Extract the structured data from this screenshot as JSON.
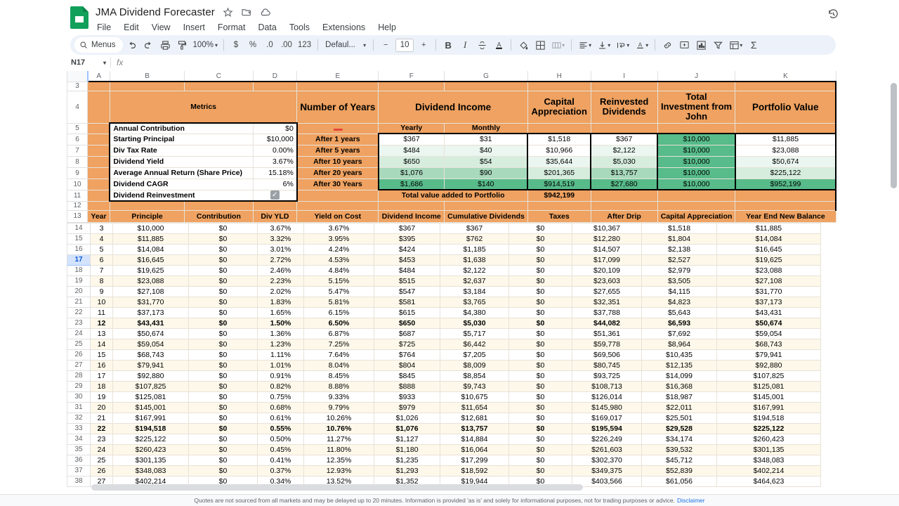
{
  "app": {
    "doc_title": "JMA Dividend Forecaster",
    "doc_icon": "sheets-icon",
    "star_icon": "star-icon",
    "move_icon": "move-to-folder-icon",
    "cloud_icon": "cloud-saved-icon",
    "history_icon": "version-history-icon",
    "menus": [
      "File",
      "Edit",
      "View",
      "Insert",
      "Format",
      "Data",
      "Tools",
      "Extensions",
      "Help"
    ]
  },
  "toolbar": {
    "menus_label": "Menus",
    "search_icon": "search-icon",
    "undo_icon": "undo-icon",
    "redo_icon": "redo-icon",
    "print_icon": "print-icon",
    "paint_icon": "paint-format-icon",
    "zoom_value": "100%",
    "currency_label": "$",
    "percent_label": "%",
    "dec_minus_label": ".0",
    "dec_plus_label": ".00",
    "formats_label": "123",
    "font_label": "Defaul...",
    "font_size": "10",
    "minus_label": "−",
    "plus_label": "+",
    "bold_label": "B",
    "italic_label": "I",
    "strike_label": "S",
    "textcolor_label": "A",
    "fill_icon": "fill-color-icon",
    "borders_icon": "borders-icon",
    "merge_icon": "merge-cells-icon",
    "align_icon": "horizontal-align-icon",
    "valign_icon": "vertical-align-icon",
    "wrap_icon": "text-wrap-icon",
    "rotate_label": "A",
    "link_icon": "insert-link-icon",
    "comment_icon": "insert-comment-icon",
    "chart_icon": "insert-chart-icon",
    "filter_icon": "filter-icon",
    "functions_icon": "pivot-icon",
    "sigma_label": "Σ"
  },
  "formula_bar": {
    "cell_ref": "N17",
    "fx_label": "fx",
    "formula_value": ""
  },
  "grid": {
    "columns": [
      "A",
      "B",
      "C",
      "D",
      "E",
      "F",
      "G",
      "H",
      "I",
      "J",
      "K"
    ],
    "rows": [
      3,
      4,
      5,
      6,
      7,
      8,
      9,
      10,
      11,
      12,
      13,
      14,
      15,
      16,
      17,
      18,
      19,
      20,
      21,
      22,
      23,
      24,
      25,
      26,
      27,
      28,
      29,
      30,
      31,
      32,
      33,
      34,
      35,
      36,
      37,
      38
    ],
    "selected_row": 17
  },
  "panel": {
    "metrics_title": "Metrics",
    "years_title": "Number of Years",
    "dividend_income_title": "Dividend Income",
    "capital_appreciation_title": "Capital Appreciation",
    "reinvested_dividends_title": "Reinvested Dividends",
    "total_investment_title": "Total Investment from John",
    "portfolio_value_title": "Portfolio Value",
    "yearly_label": "Yearly",
    "monthly_label": "Monthly",
    "total_added_label": "Total value added to Portfolio",
    "total_added_value": "$942,199",
    "metrics": [
      {
        "label": "Annual Contribution",
        "value": "$0"
      },
      {
        "label": "Starting Principal",
        "value": "$10,000"
      },
      {
        "label": "Div Tax Rate",
        "value": "0.00%"
      },
      {
        "label": "Dividend Yield",
        "value": "3.67%"
      },
      {
        "label": "Average Annual Return (Share Price)",
        "value": "15.18%"
      },
      {
        "label": "Dividend CAGR",
        "value": "6%"
      },
      {
        "label": "Dividend Reinvestment",
        "value": "✓"
      }
    ],
    "year_rows": [
      {
        "label": "After 1 years",
        "yearly": "$367",
        "monthly": "$31",
        "capital": "$1,518",
        "reinvested": "$367",
        "invested": "$10,000",
        "portfolio": "$11,885"
      },
      {
        "label": "After 5 years",
        "yearly": "$484",
        "monthly": "$40",
        "capital": "$10,966",
        "reinvested": "$2,122",
        "invested": "$10,000",
        "portfolio": "$23,088"
      },
      {
        "label": "After 10 years",
        "yearly": "$650",
        "monthly": "$54",
        "capital": "$35,644",
        "reinvested": "$5,030",
        "invested": "$10,000",
        "portfolio": "$50,674"
      },
      {
        "label": "After 20 years",
        "yearly": "$1,076",
        "monthly": "$90",
        "capital": "$201,365",
        "reinvested": "$13,757",
        "invested": "$10,000",
        "portfolio": "$225,122"
      },
      {
        "label": "After 30 Years",
        "yearly": "$1,686",
        "monthly": "$140",
        "capital": "$914,519",
        "reinvested": "$27,680",
        "invested": "$10,000",
        "portfolio": "$952,199"
      }
    ]
  },
  "table": {
    "headers": [
      "Year",
      "Principle",
      "Contribution",
      "Div YLD",
      "Yield on Cost",
      "Dividend Income",
      "Cumulative Dividends",
      "Taxes",
      "After Drip",
      "Capital Appreciation",
      "Year End New Balance"
    ],
    "rows": [
      {
        "year": "3",
        "principle": "$10,000",
        "contribution": "$0",
        "div_yld": "3.67%",
        "yoc": "3.67%",
        "income": "$367",
        "cumulative": "$367",
        "taxes": "$0",
        "after_drip": "$10,367",
        "capital": "$1,518",
        "balance": "$11,885",
        "bold": false
      },
      {
        "year": "4",
        "principle": "$11,885",
        "contribution": "$0",
        "div_yld": "3.32%",
        "yoc": "3.95%",
        "income": "$395",
        "cumulative": "$762",
        "taxes": "$0",
        "after_drip": "$12,280",
        "capital": "$1,804",
        "balance": "$14,084",
        "bold": false
      },
      {
        "year": "5",
        "principle": "$14,084",
        "contribution": "$0",
        "div_yld": "3.01%",
        "yoc": "4.24%",
        "income": "$424",
        "cumulative": "$1,185",
        "taxes": "$0",
        "after_drip": "$14,507",
        "capital": "$2,138",
        "balance": "$16,645",
        "bold": false
      },
      {
        "year": "6",
        "principle": "$16,645",
        "contribution": "$0",
        "div_yld": "2.72%",
        "yoc": "4.53%",
        "income": "$453",
        "cumulative": "$1,638",
        "taxes": "$0",
        "after_drip": "$17,099",
        "capital": "$2,527",
        "balance": "$19,625",
        "bold": false
      },
      {
        "year": "7",
        "principle": "$19,625",
        "contribution": "$0",
        "div_yld": "2.46%",
        "yoc": "4.84%",
        "income": "$484",
        "cumulative": "$2,122",
        "taxes": "$0",
        "after_drip": "$20,109",
        "capital": "$2,979",
        "balance": "$23,088",
        "bold": false
      },
      {
        "year": "8",
        "principle": "$23,088",
        "contribution": "$0",
        "div_yld": "2.23%",
        "yoc": "5.15%",
        "income": "$515",
        "cumulative": "$2,637",
        "taxes": "$0",
        "after_drip": "$23,603",
        "capital": "$3,505",
        "balance": "$27,108",
        "bold": false
      },
      {
        "year": "9",
        "principle": "$27,108",
        "contribution": "$0",
        "div_yld": "2.02%",
        "yoc": "5.47%",
        "income": "$547",
        "cumulative": "$3,184",
        "taxes": "$0",
        "after_drip": "$27,655",
        "capital": "$4,115",
        "balance": "$31,770",
        "bold": false
      },
      {
        "year": "10",
        "principle": "$31,770",
        "contribution": "$0",
        "div_yld": "1.83%",
        "yoc": "5.81%",
        "income": "$581",
        "cumulative": "$3,765",
        "taxes": "$0",
        "after_drip": "$32,351",
        "capital": "$4,823",
        "balance": "$37,173",
        "bold": false
      },
      {
        "year": "11",
        "principle": "$37,173",
        "contribution": "$0",
        "div_yld": "1.65%",
        "yoc": "6.15%",
        "income": "$615",
        "cumulative": "$4,380",
        "taxes": "$0",
        "after_drip": "$37,788",
        "capital": "$5,643",
        "balance": "$43,431",
        "bold": false
      },
      {
        "year": "12",
        "principle": "$43,431",
        "contribution": "$0",
        "div_yld": "1.50%",
        "yoc": "6.50%",
        "income": "$650",
        "cumulative": "$5,030",
        "taxes": "$0",
        "after_drip": "$44,082",
        "capital": "$6,593",
        "balance": "$50,674",
        "bold": true
      },
      {
        "year": "13",
        "principle": "$50,674",
        "contribution": "$0",
        "div_yld": "1.36%",
        "yoc": "6.87%",
        "income": "$687",
        "cumulative": "$5,717",
        "taxes": "$0",
        "after_drip": "$51,361",
        "capital": "$7,692",
        "balance": "$59,054",
        "bold": false
      },
      {
        "year": "14",
        "principle": "$59,054",
        "contribution": "$0",
        "div_yld": "1.23%",
        "yoc": "7.25%",
        "income": "$725",
        "cumulative": "$6,442",
        "taxes": "$0",
        "after_drip": "$59,778",
        "capital": "$8,964",
        "balance": "$68,743",
        "bold": false
      },
      {
        "year": "15",
        "principle": "$68,743",
        "contribution": "$0",
        "div_yld": "1.11%",
        "yoc": "7.64%",
        "income": "$764",
        "cumulative": "$7,205",
        "taxes": "$0",
        "after_drip": "$69,506",
        "capital": "$10,435",
        "balance": "$79,941",
        "bold": false
      },
      {
        "year": "16",
        "principle": "$79,941",
        "contribution": "$0",
        "div_yld": "1.01%",
        "yoc": "8.04%",
        "income": "$804",
        "cumulative": "$8,009",
        "taxes": "$0",
        "after_drip": "$80,745",
        "capital": "$12,135",
        "balance": "$92,880",
        "bold": false
      },
      {
        "year": "17",
        "principle": "$92,880",
        "contribution": "$0",
        "div_yld": "0.91%",
        "yoc": "8.45%",
        "income": "$845",
        "cumulative": "$8,854",
        "taxes": "$0",
        "after_drip": "$93,725",
        "capital": "$14,099",
        "balance": "$107,825",
        "bold": false
      },
      {
        "year": "18",
        "principle": "$107,825",
        "contribution": "$0",
        "div_yld": "0.82%",
        "yoc": "8.88%",
        "income": "$888",
        "cumulative": "$9,743",
        "taxes": "$0",
        "after_drip": "$108,713",
        "capital": "$16,368",
        "balance": "$125,081",
        "bold": false
      },
      {
        "year": "19",
        "principle": "$125,081",
        "contribution": "$0",
        "div_yld": "0.75%",
        "yoc": "9.33%",
        "income": "$933",
        "cumulative": "$10,675",
        "taxes": "$0",
        "after_drip": "$126,014",
        "capital": "$18,987",
        "balance": "$145,001",
        "bold": false
      },
      {
        "year": "20",
        "principle": "$145,001",
        "contribution": "$0",
        "div_yld": "0.68%",
        "yoc": "9.79%",
        "income": "$979",
        "cumulative": "$11,654",
        "taxes": "$0",
        "after_drip": "$145,980",
        "capital": "$22,011",
        "balance": "$167,991",
        "bold": false
      },
      {
        "year": "21",
        "principle": "$167,991",
        "contribution": "$0",
        "div_yld": "0.61%",
        "yoc": "10.26%",
        "income": "$1,026",
        "cumulative": "$12,681",
        "taxes": "$0",
        "after_drip": "$169,017",
        "capital": "$25,501",
        "balance": "$194,518",
        "bold": false
      },
      {
        "year": "22",
        "principle": "$194,518",
        "contribution": "$0",
        "div_yld": "0.55%",
        "yoc": "10.76%",
        "income": "$1,076",
        "cumulative": "$13,757",
        "taxes": "$0",
        "after_drip": "$195,594",
        "capital": "$29,528",
        "balance": "$225,122",
        "bold": true
      },
      {
        "year": "23",
        "principle": "$225,122",
        "contribution": "$0",
        "div_yld": "0.50%",
        "yoc": "11.27%",
        "income": "$1,127",
        "cumulative": "$14,884",
        "taxes": "$0",
        "after_drip": "$226,249",
        "capital": "$34,174",
        "balance": "$260,423",
        "bold": false
      },
      {
        "year": "24",
        "principle": "$260,423",
        "contribution": "$0",
        "div_yld": "0.45%",
        "yoc": "11.80%",
        "income": "$1,180",
        "cumulative": "$16,064",
        "taxes": "$0",
        "after_drip": "$261,603",
        "capital": "$39,532",
        "balance": "$301,135",
        "bold": false
      },
      {
        "year": "25",
        "principle": "$301,135",
        "contribution": "$0",
        "div_yld": "0.41%",
        "yoc": "12.35%",
        "income": "$1,235",
        "cumulative": "$17,299",
        "taxes": "$0",
        "after_drip": "$302,370",
        "capital": "$45,712",
        "balance": "$348,083",
        "bold": false
      },
      {
        "year": "26",
        "principle": "$348,083",
        "contribution": "$0",
        "div_yld": "0.37%",
        "yoc": "12.93%",
        "income": "$1,293",
        "cumulative": "$18,592",
        "taxes": "$0",
        "after_drip": "$349,375",
        "capital": "$52,839",
        "balance": "$402,214",
        "bold": false
      },
      {
        "year": "27",
        "principle": "$402,214",
        "contribution": "$0",
        "div_yld": "0.34%",
        "yoc": "13.52%",
        "income": "$1,352",
        "cumulative": "$19,944",
        "taxes": "$0",
        "after_drip": "$403,566",
        "capital": "$61,056",
        "balance": "$464,623",
        "bold": false
      }
    ]
  },
  "footer": {
    "disclaimer": "Quotes are not sourced from all markets and may be delayed up to 20 minutes. Information is provided 'as is' and solely for informational purposes, not for trading purposes or advice.",
    "disclaimer_link": "Disclaimer"
  },
  "colors": {
    "orange": "#EFA261",
    "green": "#57BB8A",
    "cream": "#fdf8e9",
    "accent_blue": "#1a73e8"
  }
}
